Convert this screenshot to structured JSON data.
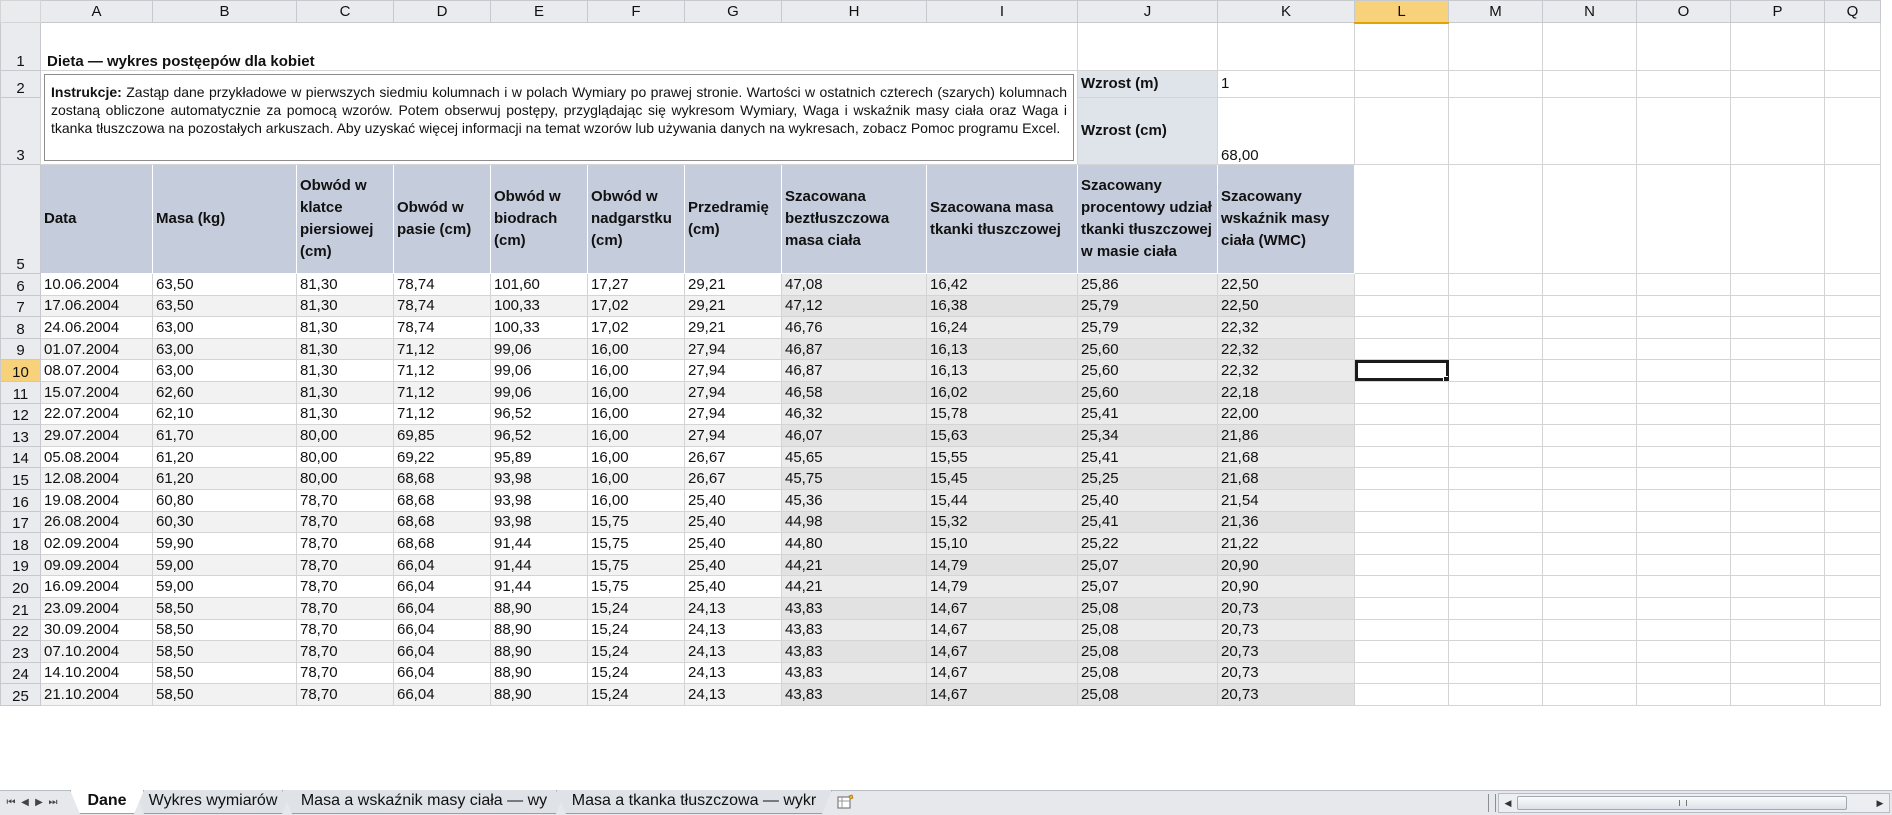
{
  "sheet": {
    "columns": [
      "A",
      "B",
      "C",
      "D",
      "E",
      "F",
      "G",
      "H",
      "I",
      "J",
      "K",
      "L",
      "M",
      "N",
      "O",
      "P",
      "Q"
    ],
    "active_column": "L",
    "active_row": 10,
    "row_numbers": [
      1,
      2,
      3,
      5,
      6,
      7,
      8,
      9,
      10,
      11,
      12,
      13,
      14,
      15,
      16,
      17,
      18,
      19,
      20,
      21,
      22,
      23,
      24,
      25
    ]
  },
  "title": "Dieta — wykres postęepów dla kobiet",
  "instructions": {
    "label": "Instrukcje:",
    "text": "Zastąp dane przykładowe  w pierwszych siedmiu kolumnach  i w polach Wymiary po prawej stronie. Wartości w ostatnich czterech (szarych) kolumnach  zostaną obliczone automatycznie  za pomocą wzorów. Potem obserwuj postępy, przyglądając  się wykresom Wymiary, Waga i wskaźnik masy ciała oraz Waga i tkanka tłuszczowa na pozostałych  arkuszach. Aby uzyskać więcej informacji na temat wzorów lub używania danych  na wykresach, zobacz Pomoc programu  Excel."
  },
  "measurements": {
    "height_m_label": "Wzrost (m)",
    "height_m_value": "1",
    "height_cm_label": "Wzrost (cm)",
    "height_cm_value": "68,00"
  },
  "headers": [
    "Data",
    "Masa (kg)",
    "Obwód w klatce piersiowej (cm)",
    "Obwód w pasie (cm)",
    "Obwód w biodrach (cm)",
    "Obwód w nadgarstku (cm)",
    "Przedramię (cm)",
    "Szacowana beztłuszczowa masa ciała",
    "Szacowana masa tkanki tłuszczowej",
    "Szacowany procentowy udział tkanki tłuszczowej w masie ciała",
    "Szacowany wskaźnik masy ciała (WMC)"
  ],
  "rows": [
    [
      "10.06.2004",
      "63,50",
      "81,30",
      "78,74",
      "101,60",
      "17,27",
      "29,21",
      "47,08",
      "16,42",
      "25,86",
      "22,50"
    ],
    [
      "17.06.2004",
      "63,50",
      "81,30",
      "78,74",
      "100,33",
      "17,02",
      "29,21",
      "47,12",
      "16,38",
      "25,79",
      "22,50"
    ],
    [
      "24.06.2004",
      "63,00",
      "81,30",
      "78,74",
      "100,33",
      "17,02",
      "29,21",
      "46,76",
      "16,24",
      "25,79",
      "22,32"
    ],
    [
      "01.07.2004",
      "63,00",
      "81,30",
      "71,12",
      "99,06",
      "16,00",
      "27,94",
      "46,87",
      "16,13",
      "25,60",
      "22,32"
    ],
    [
      "08.07.2004",
      "63,00",
      "81,30",
      "71,12",
      "99,06",
      "16,00",
      "27,94",
      "46,87",
      "16,13",
      "25,60",
      "22,32"
    ],
    [
      "15.07.2004",
      "62,60",
      "81,30",
      "71,12",
      "99,06",
      "16,00",
      "27,94",
      "46,58",
      "16,02",
      "25,60",
      "22,18"
    ],
    [
      "22.07.2004",
      "62,10",
      "81,30",
      "71,12",
      "96,52",
      "16,00",
      "27,94",
      "46,32",
      "15,78",
      "25,41",
      "22,00"
    ],
    [
      "29.07.2004",
      "61,70",
      "80,00",
      "69,85",
      "96,52",
      "16,00",
      "27,94",
      "46,07",
      "15,63",
      "25,34",
      "21,86"
    ],
    [
      "05.08.2004",
      "61,20",
      "80,00",
      "69,22",
      "95,89",
      "16,00",
      "26,67",
      "45,65",
      "15,55",
      "25,41",
      "21,68"
    ],
    [
      "12.08.2004",
      "61,20",
      "80,00",
      "68,68",
      "93,98",
      "16,00",
      "26,67",
      "45,75",
      "15,45",
      "25,25",
      "21,68"
    ],
    [
      "19.08.2004",
      "60,80",
      "78,70",
      "68,68",
      "93,98",
      "16,00",
      "25,40",
      "45,36",
      "15,44",
      "25,40",
      "21,54"
    ],
    [
      "26.08.2004",
      "60,30",
      "78,70",
      "68,68",
      "93,98",
      "15,75",
      "25,40",
      "44,98",
      "15,32",
      "25,41",
      "21,36"
    ],
    [
      "02.09.2004",
      "59,90",
      "78,70",
      "68,68",
      "91,44",
      "15,75",
      "25,40",
      "44,80",
      "15,10",
      "25,22",
      "21,22"
    ],
    [
      "09.09.2004",
      "59,00",
      "78,70",
      "66,04",
      "91,44",
      "15,75",
      "25,40",
      "44,21",
      "14,79",
      "25,07",
      "20,90"
    ],
    [
      "16.09.2004",
      "59,00",
      "78,70",
      "66,04",
      "91,44",
      "15,75",
      "25,40",
      "44,21",
      "14,79",
      "25,07",
      "20,90"
    ],
    [
      "23.09.2004",
      "58,50",
      "78,70",
      "66,04",
      "88,90",
      "15,24",
      "24,13",
      "43,83",
      "14,67",
      "25,08",
      "20,73"
    ],
    [
      "30.09.2004",
      "58,50",
      "78,70",
      "66,04",
      "88,90",
      "15,24",
      "24,13",
      "43,83",
      "14,67",
      "25,08",
      "20,73"
    ],
    [
      "07.10.2004",
      "58,50",
      "78,70",
      "66,04",
      "88,90",
      "15,24",
      "24,13",
      "43,83",
      "14,67",
      "25,08",
      "20,73"
    ],
    [
      "14.10.2004",
      "58,50",
      "78,70",
      "66,04",
      "88,90",
      "15,24",
      "24,13",
      "43,83",
      "14,67",
      "25,08",
      "20,73"
    ],
    [
      "21.10.2004",
      "58,50",
      "78,70",
      "66,04",
      "88,90",
      "15,24",
      "24,13",
      "43,83",
      "14,67",
      "25,08",
      "20,73"
    ]
  ],
  "sheet_tabs": [
    {
      "label": "Dane",
      "active": true
    },
    {
      "label": "Wykres wymiarów",
      "active": false
    },
    {
      "label": "Masa a wskaźnik masy ciała — wy",
      "active": false
    },
    {
      "label": "Masa a tkanka tłuszczowa — wykr",
      "active": false
    }
  ],
  "colors": {
    "header_fill": "#c5ccdb",
    "active_heading": "#f8d27a",
    "computed_column_fill": "#ebebeb"
  }
}
